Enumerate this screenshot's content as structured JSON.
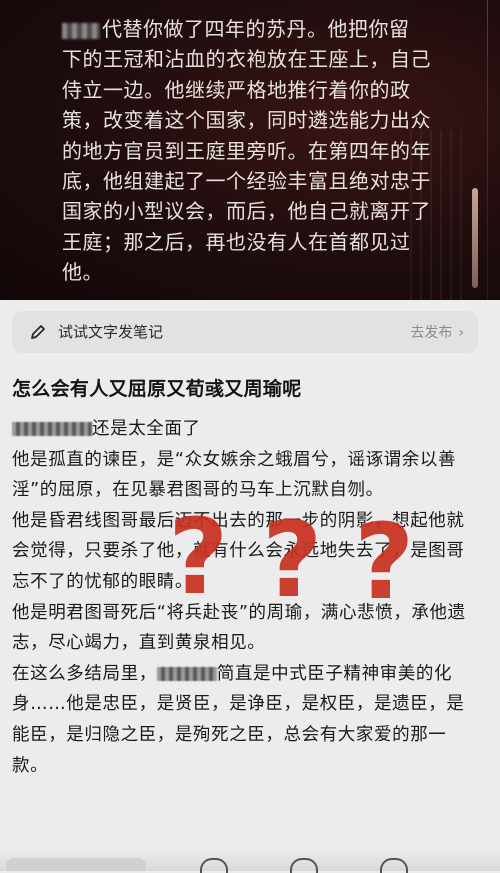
{
  "hero": {
    "lines": [
      "代替你做了四年的苏丹。他把你留",
      "下的王冠和沾血的衣袍放在王座上，自己",
      "侍立一边。他继续严格地推行着你的政",
      "策，改变着这个国家，同时遴选能力出众",
      "的地方官员到王庭里旁听。在第四年的年",
      "底，他组建起了一个经验丰富且绝对忠于",
      "国家的小型议会，而后，他自己就离开了",
      "王庭；那之后，再也没有人在首都见过",
      "他。"
    ]
  },
  "note_bar": {
    "label": "试试文字发笔记",
    "publish": "去发布",
    "chevron": "›",
    "icon": "pen-icon"
  },
  "post": {
    "title": "怎么会有人又屈原又荀彧又周瑜呢",
    "paragraphs": [
      "还是太全面了",
      "他是孤直的谏臣，是“众女嫉余之蛾眉兮，谣诼谓余以善淫”的屈原，在见暴君图哥的马车上沉默自刎。",
      "他是昏君线图哥最后迈不出去的那一步的阴影，想起他就会觉得，只要杀了他，就有什么会永远地失去了，是图哥忘不了的忧郁的眼睛。",
      "他是明君图哥死后“将兵赴丧”的周瑜，满心悲愤，承他遗志，尽心竭力，直到黄泉相见。",
      "在这么多结局里，",
      "简直是中式臣子精神审美的化身……他是忠臣，是贤臣，是诤臣，是权臣，是遗臣，是能臣，是归隐之臣，是殉死之臣，总会有大家爱的那一款。"
    ]
  },
  "overlay": {
    "mark": "?",
    "color": "#c8311f"
  }
}
